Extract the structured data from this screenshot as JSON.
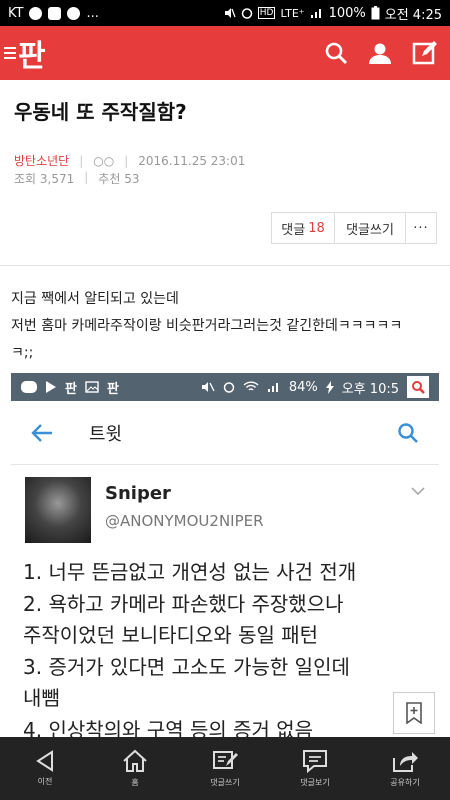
{
  "status_bar": {
    "carrier": "KT",
    "network": "LTE⁺",
    "battery": "100%",
    "time": "오전 4:25",
    "more": "..."
  },
  "app_bar": {
    "logo": "판"
  },
  "post": {
    "title": "우동네 또 주작질함?",
    "author": "방탄소년단",
    "author_mark": "○○",
    "date": "2016.11.25 23:01",
    "views": "조회 3,571",
    "recommends": "추천 53",
    "actions": {
      "comments_label": "댓글",
      "comments_count": "18",
      "write_label": "댓글쓰기",
      "more": "···"
    },
    "body": [
      "지금 짹에서 알티되고 있는데",
      "저번 홈마 카메라주작이랑 비슷판거라그러는것 같긴한데ㅋㅋㅋㅋㅋ",
      "ㅋ;;"
    ]
  },
  "embed": {
    "status": {
      "battery": "84%",
      "time": "오후 10:5"
    },
    "nav_title": "트윗",
    "tweet": {
      "name": "Sniper",
      "handle": "@ANONYMOU2NIPER",
      "lines": [
        "1. 너무 뜬금없고 개연성 없는 사건 전개",
        "2. 욕하고 카메라 파손했다 주장했으나",
        "주작이었던 보니타디오와 동일 패턴",
        "3. 증거가 있다면 고소도 가능한 일인데",
        "내뺌",
        "4. 인상착의와 구역 등의 증거 없음"
      ]
    }
  },
  "bottom_nav": [
    {
      "icon": "back-arrow-icon",
      "label": "이전"
    },
    {
      "icon": "home-icon",
      "label": "홈"
    },
    {
      "icon": "write-icon",
      "label": "댓글쓰기"
    },
    {
      "icon": "comment-icon",
      "label": "댓글보기"
    },
    {
      "icon": "share-icon",
      "label": "공유하기"
    }
  ],
  "colors": {
    "brand": "#e63c3c",
    "accent_text": "#e04040",
    "twitter_blue": "#3b8fd6"
  }
}
